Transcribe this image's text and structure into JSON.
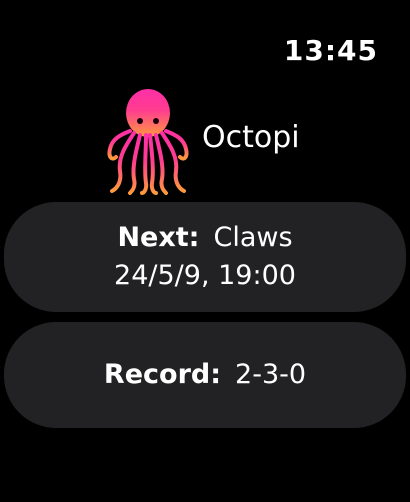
{
  "status": {
    "time": "13:45"
  },
  "app": {
    "title": "Octopi",
    "logo_icon": "octopus-icon",
    "logo_gradient": [
      "#ff2fa8",
      "#ff8a3c"
    ]
  },
  "next_game": {
    "label": "Next:",
    "opponent": "Claws",
    "datetime": "24/5/9, 19:00"
  },
  "record": {
    "label": "Record:",
    "value": "2-3-0"
  },
  "colors": {
    "background": "#000000",
    "card": "#222224",
    "text": "#ffffff"
  }
}
